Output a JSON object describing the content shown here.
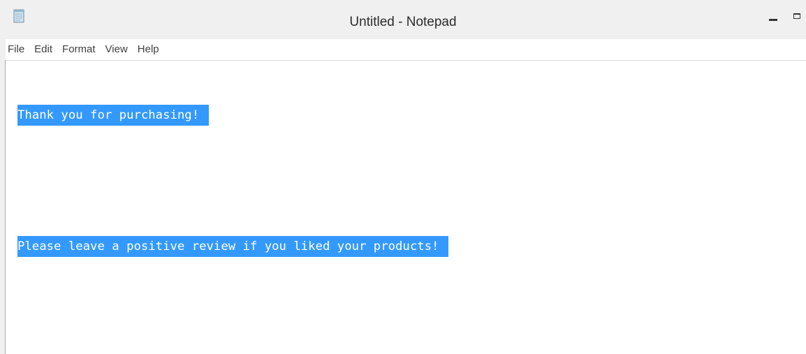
{
  "window": {
    "title": "Untitled - Notepad",
    "app_icon": "notepad-icon",
    "controls": [
      "minimize-icon",
      "maximize-icon"
    ]
  },
  "menubar": {
    "items": [
      {
        "label": "File"
      },
      {
        "label": "Edit"
      },
      {
        "label": "Format"
      },
      {
        "label": "View"
      },
      {
        "label": "Help"
      }
    ]
  },
  "editor": {
    "lines": [
      "Thank you for purchasing!",
      "",
      "Please leave a positive review if you liked your products!"
    ],
    "selection": "all",
    "selection_color": "#3399ff"
  }
}
